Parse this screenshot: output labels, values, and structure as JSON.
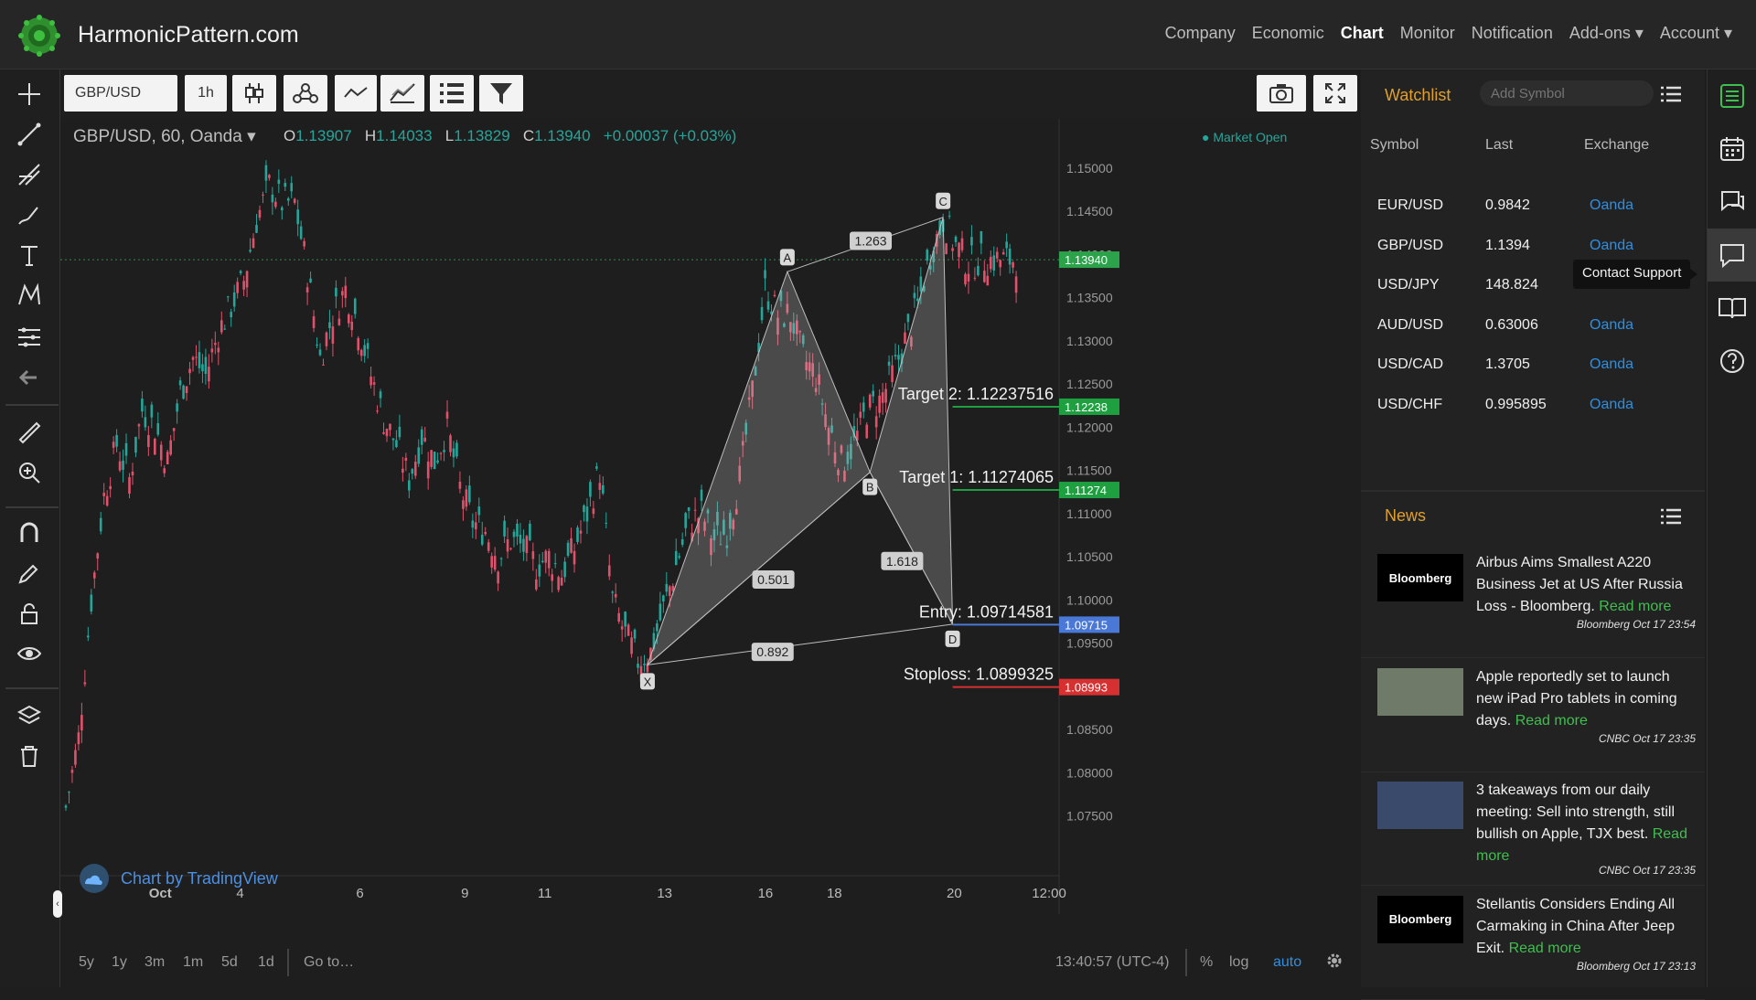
{
  "nav": {
    "brand": "HarmonicPattern.com",
    "items": [
      {
        "label": "Company",
        "active": false
      },
      {
        "label": "Economic",
        "active": false
      },
      {
        "label": "Chart",
        "active": true
      },
      {
        "label": "Monitor",
        "active": false
      },
      {
        "label": "Notification",
        "active": false
      },
      {
        "label": "Add-ons ▾",
        "active": false
      },
      {
        "label": "Account ▾",
        "active": false
      }
    ]
  },
  "toolbar": {
    "symbol": "GBP/USD",
    "interval": "1h"
  },
  "chart_header": {
    "title": "GBP/USD, 60, Oanda ▾",
    "o_label": "O",
    "o": "1.13907",
    "h_label": "H",
    "h": "1.14033",
    "l_label": "L",
    "l": "1.13829",
    "c_label": "C",
    "c": "1.13940",
    "change": "+0.00037 (+0.03%)",
    "market_status": "● Market Open"
  },
  "chart_data": {
    "type": "line",
    "symbol": "GBP/USD",
    "interval": "60",
    "ylim": [
      1.07,
      1.152
    ],
    "y_ticks": [
      "1.15000",
      "1.14500",
      "1.14000",
      "1.13500",
      "1.13000",
      "1.12500",
      "1.12000",
      "1.11500",
      "1.11000",
      "1.10500",
      "1.10000",
      "1.09500",
      "1.09000",
      "1.08500",
      "1.08000",
      "1.07500"
    ],
    "x_ticks": [
      "Oct",
      "4",
      "6",
      "9",
      "11",
      "13",
      "16",
      "18",
      "20",
      "12:00"
    ],
    "last_price_label": "1.13940",
    "series": [
      {
        "x": [
          0,
          4,
          8,
          12,
          16,
          20,
          24,
          28,
          32,
          36,
          40,
          44,
          48,
          52,
          56,
          60,
          64,
          68,
          72,
          76,
          80,
          84,
          88,
          92,
          96,
          100,
          104,
          108,
          112,
          116,
          120,
          124,
          128,
          132,
          136,
          140,
          144,
          148,
          152,
          156,
          160,
          164,
          168,
          172,
          176,
          180,
          184,
          188,
          192,
          196,
          200,
          204,
          208,
          212,
          216,
          220,
          224,
          228,
          232,
          236,
          240,
          244,
          248,
          252,
          256,
          260,
          264,
          268,
          272,
          276,
          280,
          284,
          288,
          292,
          296,
          300
        ],
        "values": [
          1.076,
          1.084,
          1.1,
          1.112,
          1.118,
          1.114,
          1.122,
          1.12,
          1.116,
          1.124,
          1.128,
          1.126,
          1.131,
          1.134,
          1.137,
          1.144,
          1.148,
          1.146,
          1.146,
          1.138,
          1.128,
          1.133,
          1.136,
          1.132,
          1.126,
          1.121,
          1.118,
          1.114,
          1.119,
          1.116,
          1.12,
          1.113,
          1.109,
          1.108,
          1.105,
          1.107,
          1.106,
          1.104,
          1.105,
          1.103,
          1.106,
          1.11,
          1.115,
          1.1,
          1.096,
          1.093,
          1.094,
          1.099,
          1.104,
          1.109,
          1.11,
          1.107,
          1.108,
          1.114,
          1.124,
          1.136,
          1.133,
          1.133,
          1.128,
          1.126,
          1.12,
          1.116,
          1.118,
          1.122,
          1.123,
          1.126,
          1.13,
          1.134,
          1.14,
          1.144,
          1.141,
          1.139,
          1.1394,
          1.1394,
          1.1394,
          1.1394
        ]
      }
    ],
    "pattern": {
      "name": "XABCD",
      "points": [
        {
          "label": "X",
          "t": 183,
          "price": 1.0925
        },
        {
          "label": "A",
          "t": 227,
          "price": 1.138
        },
        {
          "label": "B",
          "t": 253,
          "price": 1.1148
        },
        {
          "label": "C",
          "t": 276,
          "price": 1.1443
        },
        {
          "label": "D",
          "t": 279,
          "price": 1.0972
        }
      ],
      "ratios": [
        {
          "label": "1.263"
        },
        {
          "label": "0.501"
        },
        {
          "label": "1.618"
        },
        {
          "label": "0.892"
        }
      ]
    },
    "levels": [
      {
        "name": "Target 2",
        "label": "Target 2: 1.12237516",
        "price": 1.12238,
        "tag": "1.12238",
        "color": "#1fa040"
      },
      {
        "name": "Target 1",
        "label": "Target 1: 1.11274065",
        "price": 1.11274,
        "tag": "1.11274",
        "color": "#1fa040"
      },
      {
        "name": "Entry",
        "label": "Entry: 1.09714581",
        "price": 1.09715,
        "tag": "1.09715",
        "color": "#4a78d6"
      },
      {
        "name": "Stoploss",
        "label": "Stoploss: 1.0899325",
        "price": 1.08993,
        "tag": "1.08993",
        "color": "#d63030"
      }
    ]
  },
  "tv_badge": "Chart by TradingView",
  "bottom": {
    "ranges": [
      "5y",
      "1y",
      "3m",
      "1m",
      "5d",
      "1d"
    ],
    "goto": "Go to…",
    "time": "13:40:57 (UTC-4)",
    "pct": "%",
    "log": "log",
    "auto": "auto"
  },
  "watchlist": {
    "title": "Watchlist",
    "placeholder": "Add Symbol",
    "columns": [
      "Symbol",
      "Last",
      "Exchange"
    ],
    "rows": [
      {
        "symbol": "EUR/USD",
        "last": "0.9842",
        "exchange": "Oanda"
      },
      {
        "symbol": "GBP/USD",
        "last": "1.1394",
        "exchange": "Oanda"
      },
      {
        "symbol": "USD/JPY",
        "last": "148.824",
        "exchange": ""
      },
      {
        "symbol": "AUD/USD",
        "last": "0.63006",
        "exchange": "Oanda"
      },
      {
        "symbol": "USD/CAD",
        "last": "1.3705",
        "exchange": "Oanda"
      },
      {
        "symbol": "USD/CHF",
        "last": "0.995895",
        "exchange": "Oanda"
      }
    ]
  },
  "tooltip": "Contact Support",
  "news": {
    "title": "News",
    "items": [
      {
        "thumb": "Bloomberg",
        "headline": "Airbus Aims Smallest A220 Business Jet at US After Russia Loss - Bloomberg.",
        "readmore": "Read more",
        "source": "Bloomberg Oct 17 23:54"
      },
      {
        "thumb": "",
        "headline": "Apple reportedly set to launch new iPad Pro tablets in coming days.",
        "readmore": "Read more",
        "source": "CNBC Oct 17 23:35"
      },
      {
        "thumb": "",
        "headline": "3 takeaways from our daily meeting: Sell into strength, still bullish on Apple, TJX best.",
        "readmore": "Read more",
        "source": "CNBC Oct 17 23:35"
      },
      {
        "thumb": "Bloomberg",
        "headline": "Stellantis Considers Ending All Carmaking in China After Jeep Exit.",
        "readmore": "Read more",
        "source": "Bloomberg Oct 17 23:13"
      }
    ]
  }
}
